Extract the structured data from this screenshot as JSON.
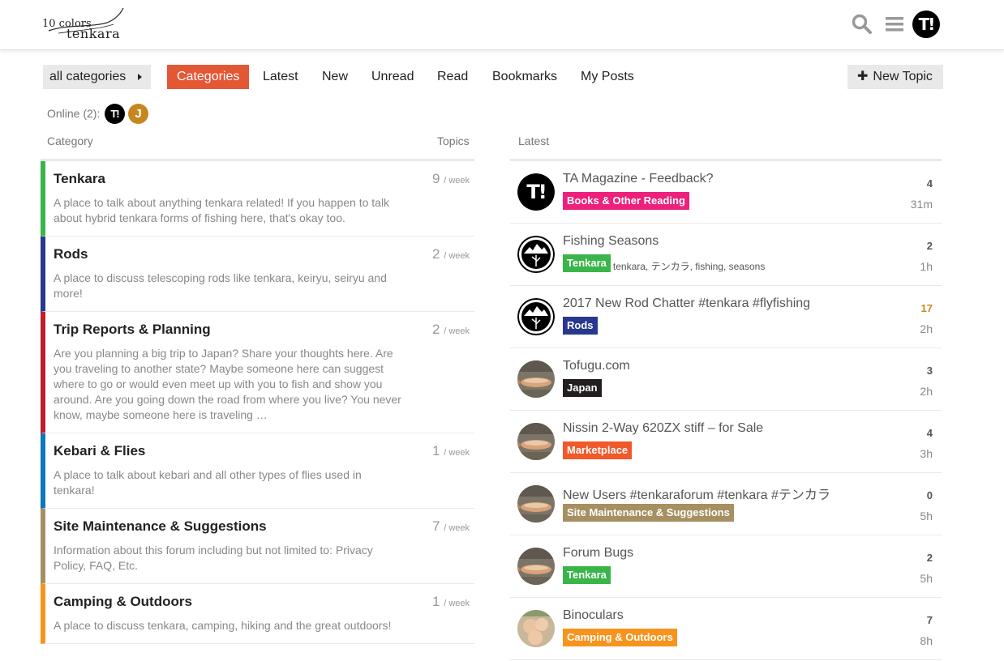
{
  "header": {
    "logo_small": "10 colors",
    "logo_big": "tenkara",
    "avatar_text": "T!"
  },
  "nav": {
    "category_dropdown": "all categories",
    "tabs": [
      {
        "label": "Categories",
        "active": true
      },
      {
        "label": "Latest"
      },
      {
        "label": "New"
      },
      {
        "label": "Unread"
      },
      {
        "label": "Read"
      },
      {
        "label": "Bookmarks"
      },
      {
        "label": "My Posts"
      }
    ],
    "new_topic": "New Topic"
  },
  "online": {
    "label": "Online (2):",
    "users": [
      {
        "initial": "T!",
        "color": "#000000"
      },
      {
        "initial": "J",
        "color": "#c8861e"
      }
    ]
  },
  "categories_table": {
    "col_category": "Category",
    "col_topics": "Topics",
    "per_label": "/ week",
    "rows": [
      {
        "name": "Tenkara",
        "color": "#3ab54a",
        "count": "9",
        "desc": "A place to talk about anything tenkara related! If you happen to talk about hybrid tenkara forms of fishing here, that's okay too."
      },
      {
        "name": "Rods",
        "color": "#283890",
        "count": "2",
        "desc": "A place to discuss telescoping rods like tenkara, keiryu, seiryu and more!"
      },
      {
        "name": "Trip Reports & Planning",
        "color": "#bf1e2e",
        "count": "2",
        "desc": "Are you planning a big trip to Japan? Share your thoughts here. Are you traveling to another state? Maybe someone here can suggest where to go or would even meet up with you to fish and show you around. Are you going down the road from where you live? You never know, maybe someone here is traveling …"
      },
      {
        "name": "Kebari & Flies",
        "color": "#0e76bd",
        "count": "1",
        "desc": "A place to talk about kebari and all other types of flies used in tenkara!"
      },
      {
        "name": "Site Maintenance & Suggestions",
        "color": "#a69061",
        "count": "7",
        "desc": "Information about this forum including but not limited to: Privacy Policy, FAQ, Etc."
      },
      {
        "name": "Camping & Outdoors",
        "color": "#f7941d",
        "count": "1",
        "desc": "A place to discuss tenkara, camping, hiking and the great outdoors!"
      }
    ]
  },
  "latest_table": {
    "col_latest": "Latest",
    "topics": [
      {
        "title": "TA Magazine - Feedback?",
        "badge": "Books & Other Reading",
        "badge_color": "#ed207b",
        "tags": "",
        "posts": "4",
        "time": "31m",
        "avatar": "ta-logo"
      },
      {
        "title": "Fishing Seasons",
        "badge": "Tenkara",
        "badge_color": "#3ab54a",
        "tags": "tenkara, テンカラ, fishing, seasons",
        "posts": "2",
        "time": "1h",
        "avatar": "mountain-logo"
      },
      {
        "title": "2017 New Rod Chatter #tenkara #flyfishing",
        "badge": "Rods",
        "badge_color": "#283890",
        "tags": "",
        "posts": "17",
        "hot": true,
        "time": "2h",
        "avatar": "mountain-logo"
      },
      {
        "title": "Tofugu.com",
        "badge": "Japan",
        "badge_color": "#231f20",
        "tags": "",
        "posts": "3",
        "time": "2h",
        "avatar": "fish-photo"
      },
      {
        "title": "Nissin 2-Way 620ZX stiff – for Sale",
        "badge": "Marketplace",
        "badge_color": "#f1592a",
        "tags": "",
        "posts": "4",
        "time": "3h",
        "avatar": "fish-photo"
      },
      {
        "title": "New Users #tenkaraforum #tenkara #テンカラ",
        "badge": "Site Maintenance & Suggestions",
        "badge_color": "#a69061",
        "tags": "",
        "posts": "0",
        "time": "5h",
        "avatar": "fish-photo"
      },
      {
        "title": "Forum Bugs",
        "badge": "Tenkara",
        "badge_color": "#3ab54a",
        "tags": "",
        "posts": "2",
        "time": "5h",
        "avatar": "fish-photo"
      },
      {
        "title": "Binoculars",
        "badge": "Camping & Outdoors",
        "badge_color": "#f7941d",
        "tags": "",
        "posts": "7",
        "time": "8h",
        "avatar": "family-photo"
      }
    ]
  }
}
